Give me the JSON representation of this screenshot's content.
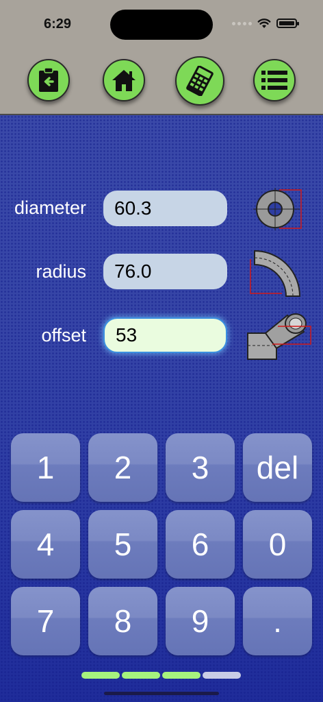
{
  "status": {
    "time": "6:29"
  },
  "nav": [
    {
      "icon": "clipboard-back-icon"
    },
    {
      "icon": "home-icon"
    },
    {
      "icon": "calculator-icon"
    },
    {
      "icon": "list-icon"
    }
  ],
  "fields": {
    "diameter": {
      "label": "diameter",
      "value": "60.3"
    },
    "radius": {
      "label": "radius",
      "value": "76.0"
    },
    "offset": {
      "label": "offset",
      "value": "53"
    }
  },
  "keypad": {
    "row1": [
      "1",
      "2",
      "3",
      "del"
    ],
    "row2": [
      "4",
      "5",
      "6",
      "0"
    ],
    "row3": [
      "7",
      "8",
      "9",
      "."
    ]
  },
  "pages": {
    "count": 4,
    "active_index": 3
  },
  "colors": {
    "accent_green": "#7ed957",
    "field_bg": "#c7d5e6",
    "active_field_bg": "#eafcdf",
    "background_blue": "#2c3aa0"
  }
}
